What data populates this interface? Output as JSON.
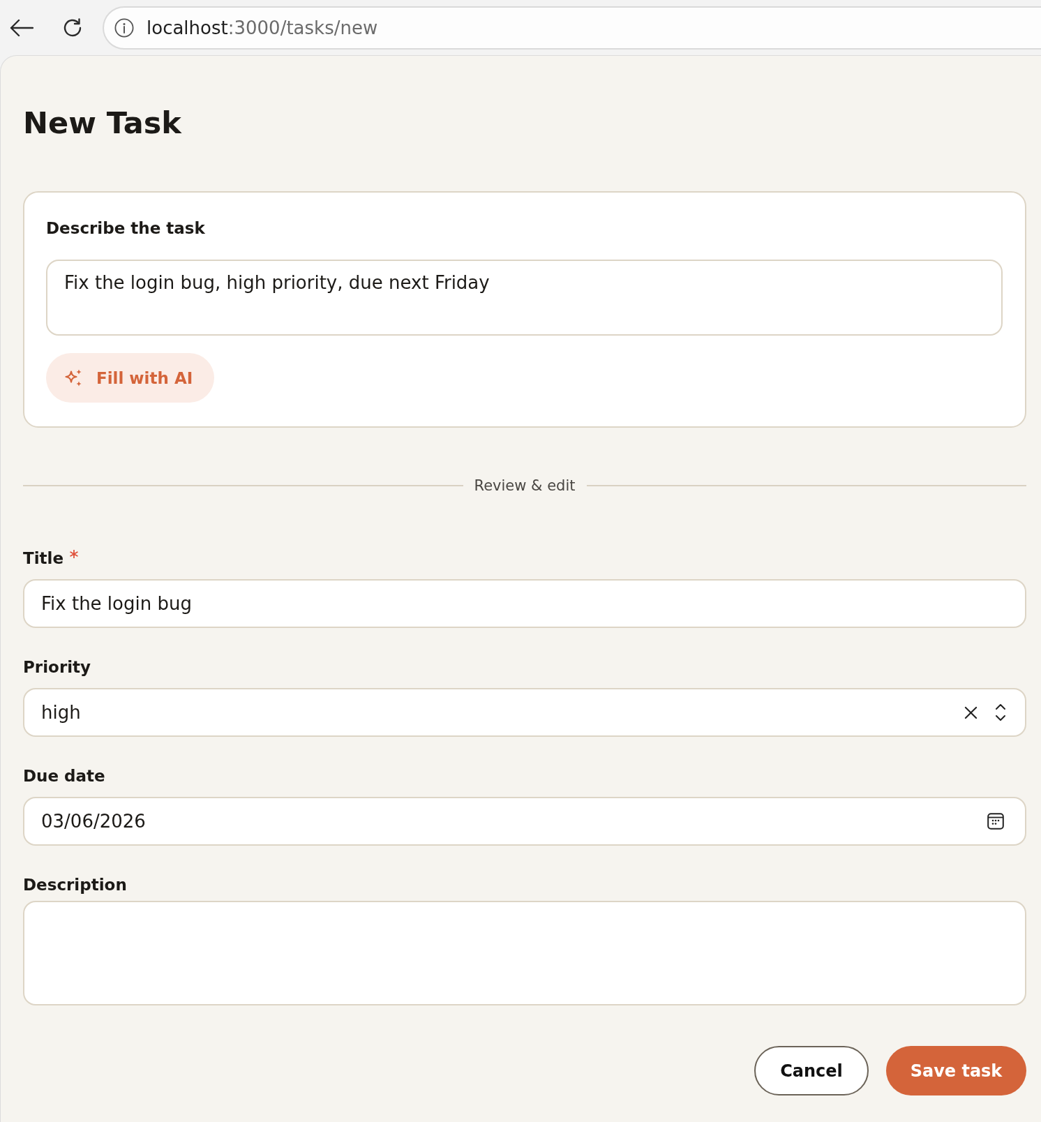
{
  "browser": {
    "url_host": "localhost",
    "url_path": ":3000/tasks/new"
  },
  "page": {
    "title": "New Task"
  },
  "describe_card": {
    "label": "Describe the task",
    "value": "Fix the login bug, high priority, due next Friday",
    "button": "Fill with AI"
  },
  "divider": {
    "label": "Review & edit"
  },
  "fields": [
    {
      "kind": "text",
      "label": "Title",
      "required": true,
      "value": "Fix the login bug"
    },
    {
      "kind": "select",
      "label": "Priority",
      "required": false,
      "value": "high"
    },
    {
      "kind": "date",
      "label": "Due date",
      "required": false,
      "value": "03/06/2026"
    },
    {
      "kind": "textarea",
      "label": "Description",
      "required": false
    }
  ],
  "actions": [
    {
      "kind": "secondary",
      "label": "Cancel"
    },
    {
      "kind": "primary",
      "label": "Save task"
    }
  ]
}
